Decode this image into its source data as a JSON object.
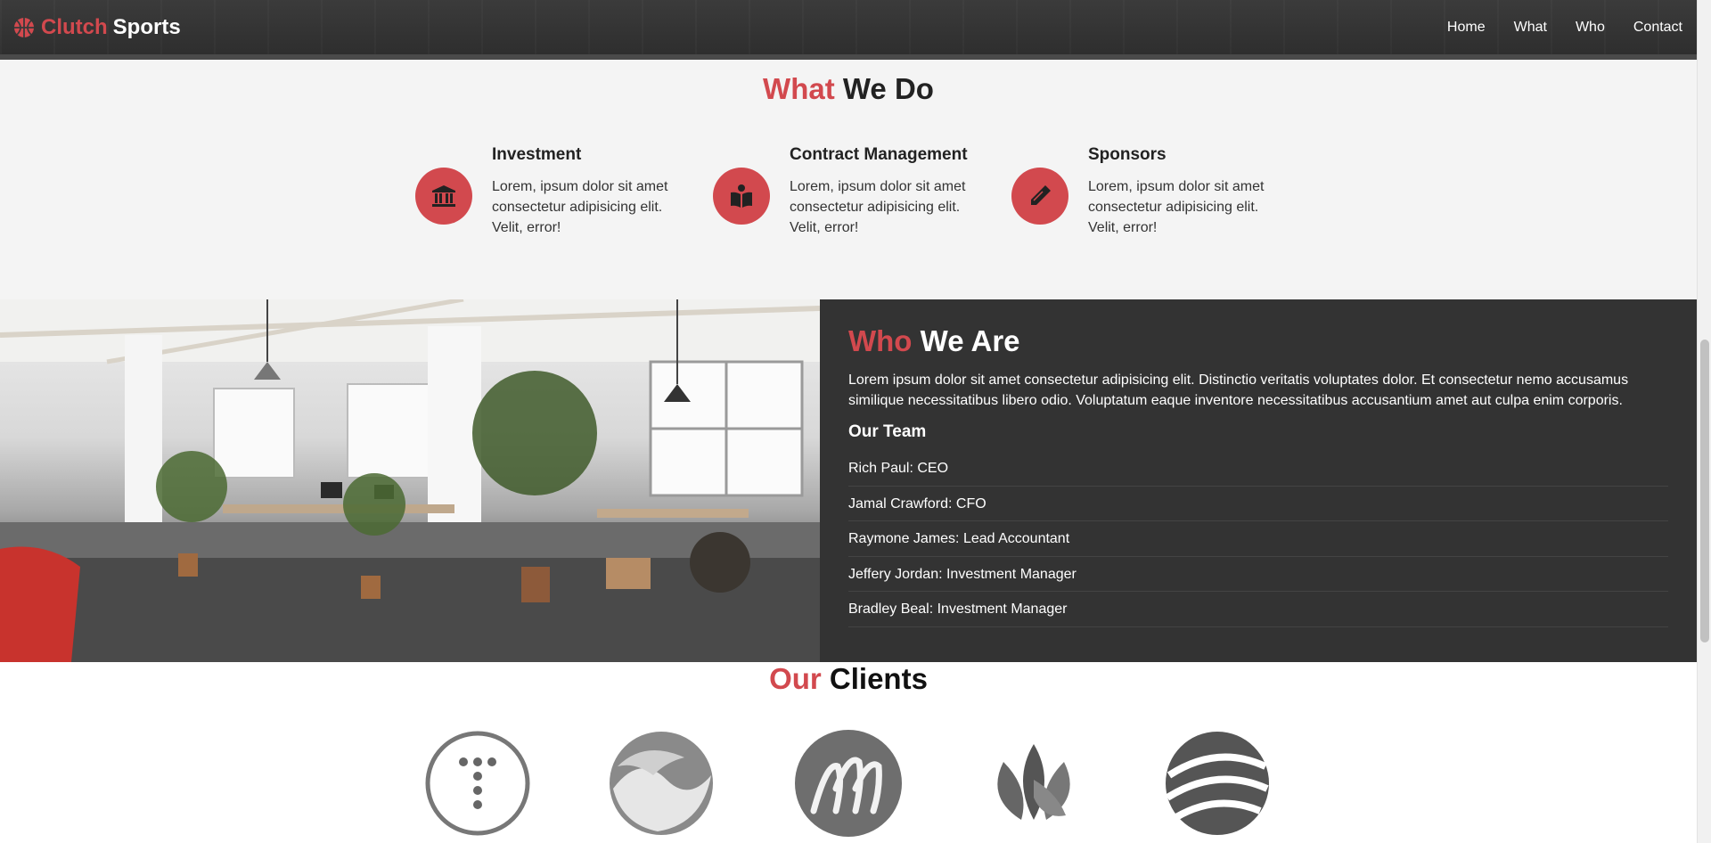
{
  "brand": {
    "name_accent": "Clutch",
    "name_rest": "Sports"
  },
  "nav": [
    {
      "label": "Home"
    },
    {
      "label": "What"
    },
    {
      "label": "Who"
    },
    {
      "label": "Contact"
    }
  ],
  "what": {
    "title_accent": "What",
    "title_rest": "We Do",
    "services": [
      {
        "title": "Investment",
        "text": "Lorem, ipsum dolor sit amet consectetur adipisicing elit. Velit, error!",
        "icon": "bank-icon"
      },
      {
        "title": "Contract Management",
        "text": "Lorem, ipsum dolor sit amet consectetur adipisicing elit. Velit, error!",
        "icon": "book-icon"
      },
      {
        "title": "Sponsors",
        "text": "Lorem, ipsum dolor sit amet consectetur adipisicing elit. Velit, error!",
        "icon": "pencil-icon"
      }
    ]
  },
  "who": {
    "title_accent": "Who",
    "title_rest": "We Are",
    "text": "Lorem ipsum dolor sit amet consectetur adipisicing elit. Distinctio veritatis voluptates dolor. Et consectetur nemo accusamus similique necessitatibus libero odio. Voluptatum eaque inventore necessitatibus accusantium amet aut culpa enim corporis.",
    "team_heading": "Our Team",
    "team": [
      "Rich Paul: CEO",
      "Jamal Crawford: CFO",
      "Raymone James: Lead Accountant",
      "Jeffery Jordan: Investment Manager",
      "Bradley Beal: Investment Manager"
    ]
  },
  "clients": {
    "title_accent": "Our",
    "title_rest": "Clients",
    "logos": [
      "t-dots-logo",
      "swirl-sphere-logo",
      "script-m-logo",
      "leaves-logo",
      "striped-globe-logo"
    ]
  },
  "colors": {
    "accent": "#d2494e",
    "dark": "#333333",
    "light_bg": "#f4f4f4"
  }
}
